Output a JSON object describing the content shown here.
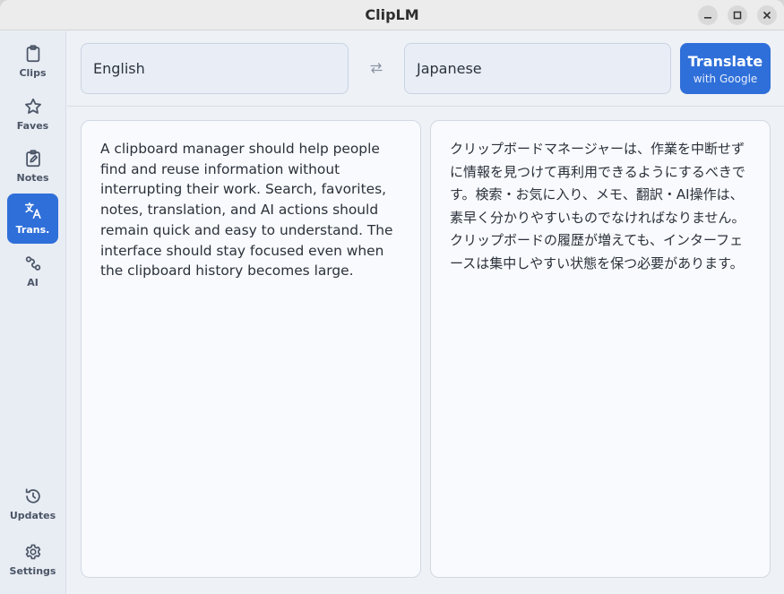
{
  "window": {
    "title": "ClipLM"
  },
  "sidebar": {
    "top_items": [
      {
        "label": "Clips",
        "icon": "clipboard-icon",
        "active": false
      },
      {
        "label": "Faves",
        "icon": "star-icon",
        "active": false
      },
      {
        "label": "Notes",
        "icon": "note-edit-icon",
        "active": false
      },
      {
        "label": "Trans.",
        "icon": "translate-icon",
        "active": true
      },
      {
        "label": "AI",
        "icon": "ai-icon",
        "active": false
      }
    ],
    "bottom_items": [
      {
        "label": "Updates",
        "icon": "history-icon"
      },
      {
        "label": "Settings",
        "icon": "gear-icon"
      }
    ]
  },
  "translate": {
    "source_language": "English",
    "target_language": "Japanese",
    "button_label": "Translate",
    "button_sublabel": "with Google",
    "source_text": "A clipboard manager should help people find and reuse information without interrupting their work. Search, favorites, notes, translation, and AI actions should remain quick and easy to understand. The interface should stay focused even when the clipboard history becomes large.",
    "target_text": "クリップボードマネージャーは、作業を中断せずに情報を見つけて再利用できるようにするべきです。検索・お気に入り、メモ、翻訳・AI操作は、素早く分かりやすいものでなければなりません。クリップボードの履歴が増えても、インターフェースは集中しやすい状態を保つ必要があります。"
  },
  "colors": {
    "accent": "#2f6fd9",
    "sidebar_bg": "#e8ecf3",
    "panel_bg": "#f8fafd"
  }
}
